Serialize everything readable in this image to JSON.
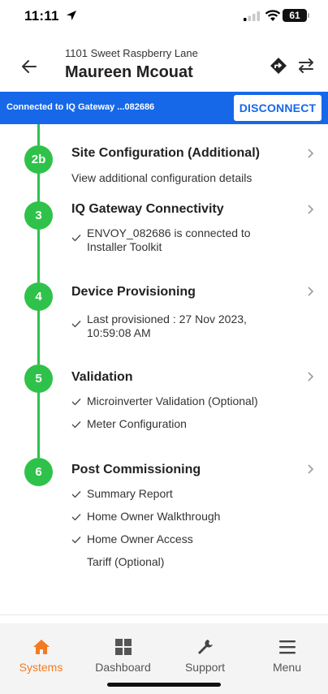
{
  "status_bar": {
    "time": "11:11",
    "battery": "61"
  },
  "header": {
    "address": "1101 Sweet Raspberry Lane",
    "name": "Maureen Mcouat"
  },
  "banner": {
    "text": "Connected to IQ Gateway ...082686",
    "disconnect_label": "DISCONNECT",
    "color": "#1668e8"
  },
  "steps": [
    {
      "badge": "2b",
      "title": "Site Configuration (Additional)",
      "details": [
        "View additional configuration details"
      ]
    },
    {
      "badge": "3",
      "title": "IQ Gateway Connectivity",
      "details": [
        "ENVOY_082686 is connected to",
        "Installer Toolkit"
      ]
    },
    {
      "badge": "4",
      "title": "Device Provisioning",
      "details": [
        "Last provisioned : 27 Nov 2023,",
        "10:59:08 AM"
      ]
    },
    {
      "badge": "5",
      "title": "Validation",
      "details": [
        "Microinverter Validation (Optional)",
        "Meter Configuration"
      ]
    },
    {
      "badge": "6",
      "title": "Post Commissioning",
      "details": [
        "Summary Report",
        "Home Owner Walkthrough",
        "Home Owner Access",
        "Tariff (Optional)"
      ]
    }
  ],
  "accent_green": "#2fc24a",
  "accent_orange": "#f47a20",
  "nav": {
    "items": [
      {
        "label": "Systems",
        "icon": "home-icon",
        "active": true
      },
      {
        "label": "Dashboard",
        "icon": "dashboard-icon",
        "active": false
      },
      {
        "label": "Support",
        "icon": "wrench-icon",
        "active": false
      },
      {
        "label": "Menu",
        "icon": "menu-icon",
        "active": false
      }
    ]
  }
}
